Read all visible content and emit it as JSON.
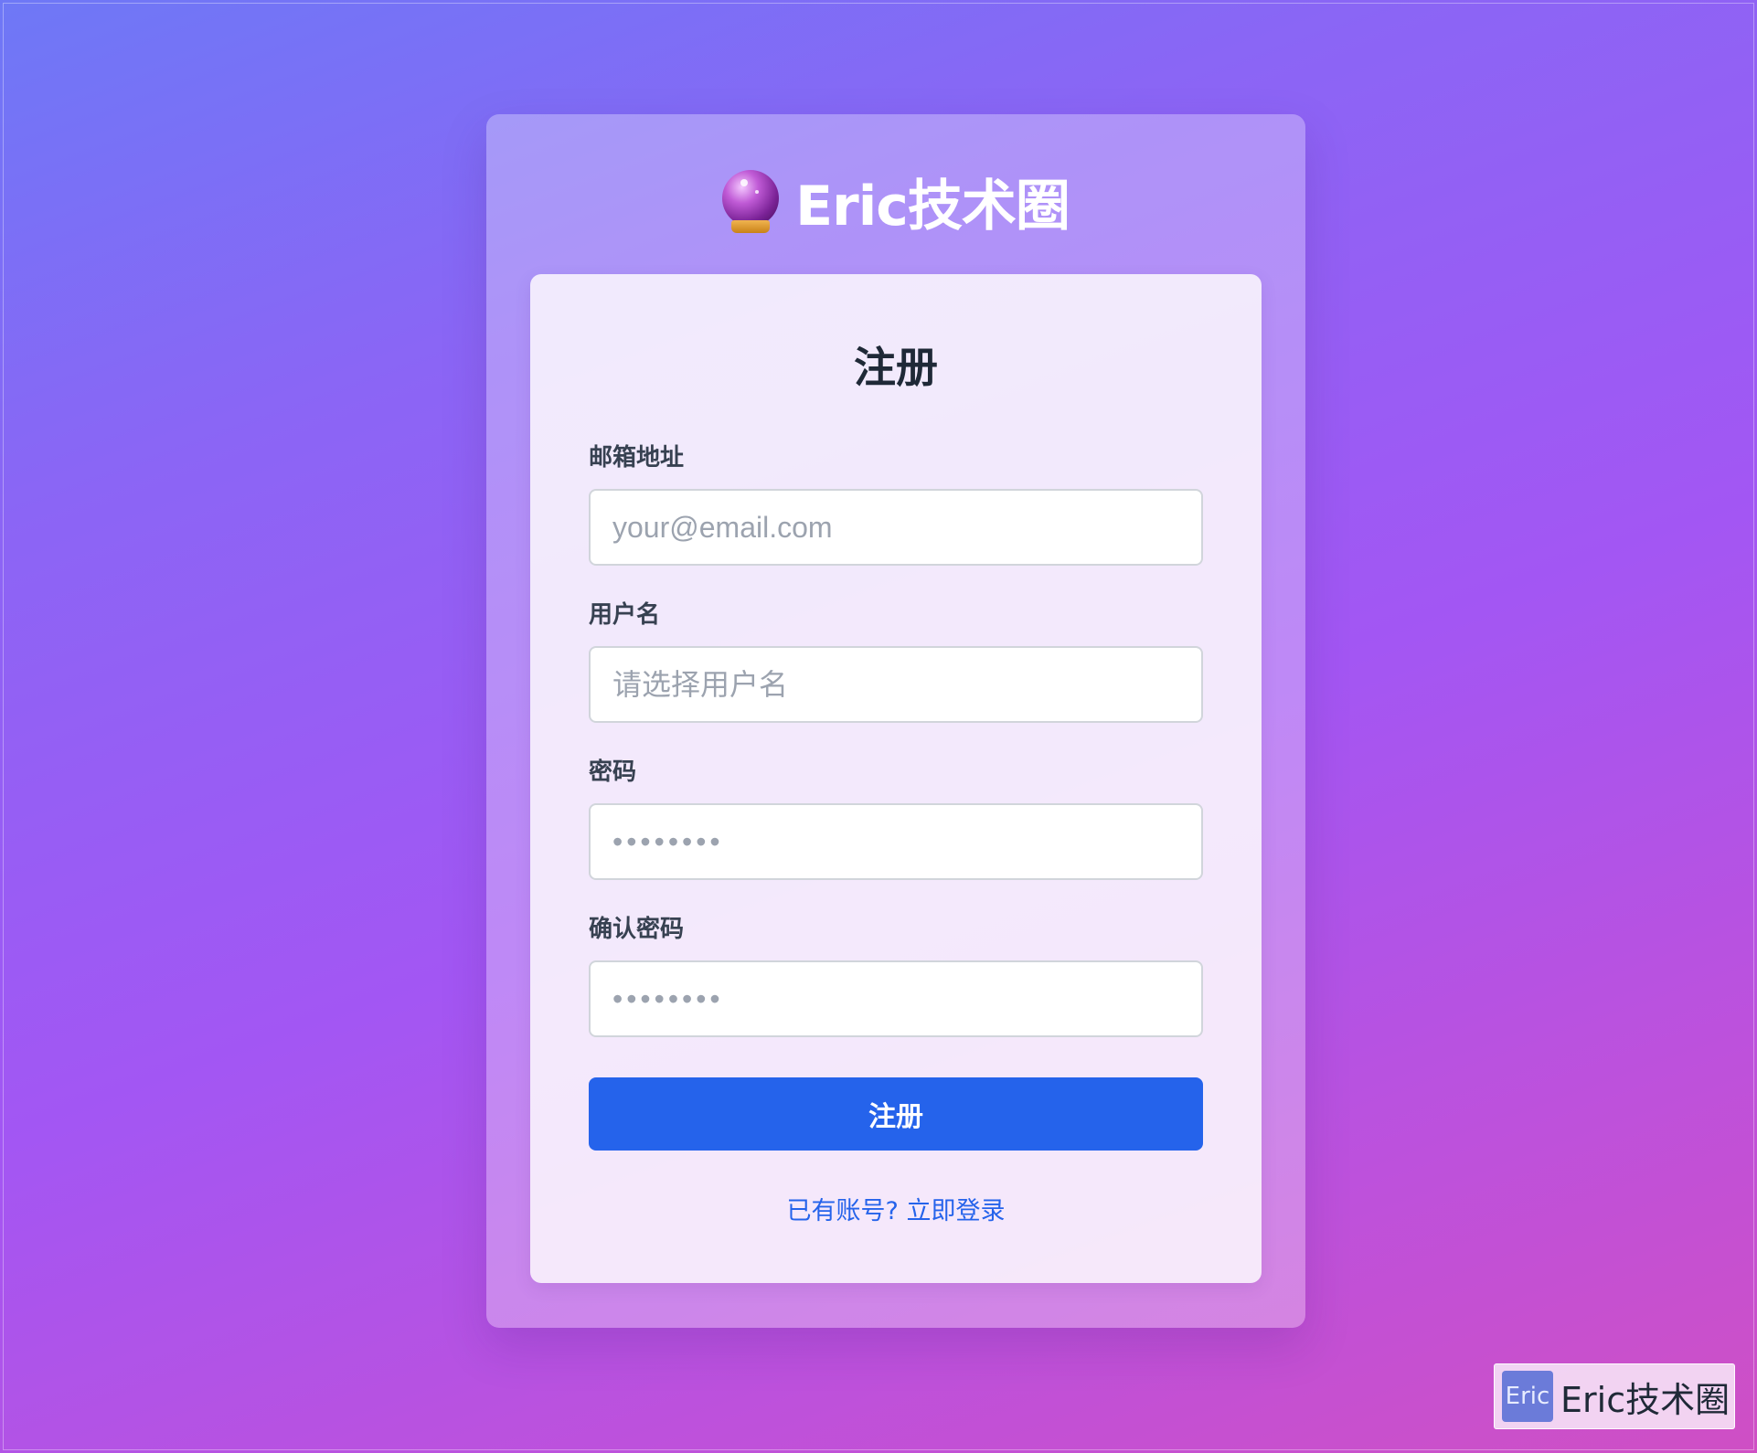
{
  "brand": {
    "icon": "crystal-ball-icon",
    "title": "Eric技术圈"
  },
  "form": {
    "title": "注册",
    "fields": [
      {
        "label": "邮箱地址",
        "placeholder": "your@email.com",
        "value": "",
        "type": "email"
      },
      {
        "label": "用户名",
        "placeholder": "请选择用户名",
        "value": "",
        "type": "text"
      },
      {
        "label": "密码",
        "placeholder": "••••••••",
        "value": "",
        "type": "password"
      },
      {
        "label": "确认密码",
        "placeholder": "••••••••",
        "value": "",
        "type": "password"
      }
    ],
    "submit_label": "注册",
    "login_link": "已有账号? 立即登录"
  },
  "watermark": {
    "logo_text": "Eric",
    "text": "Eric技术圈"
  },
  "colors": {
    "primary": "#2563eb",
    "background_start": "#6e78f6",
    "background_end": "#cf4fc4"
  }
}
